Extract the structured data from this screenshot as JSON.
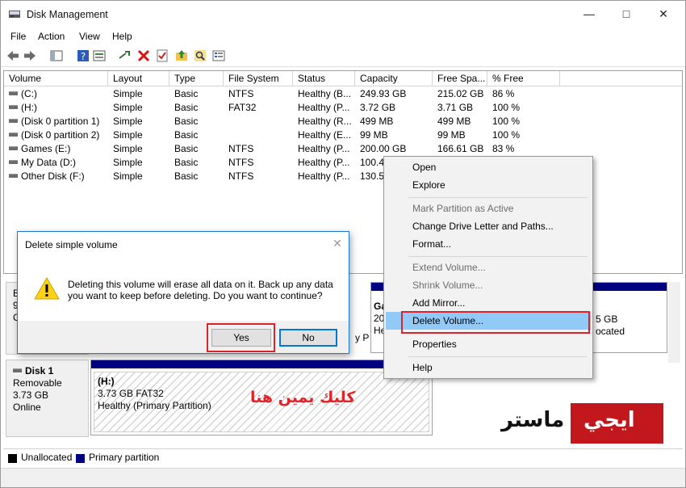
{
  "window": {
    "title": "Disk Management"
  },
  "menu": [
    "File",
    "Action",
    "View",
    "Help"
  ],
  "columns": [
    "Volume",
    "Layout",
    "Type",
    "File System",
    "Status",
    "Capacity",
    "Free Spa...",
    "% Free"
  ],
  "volumes": [
    {
      "volume": "(C:)",
      "layout": "Simple",
      "type": "Basic",
      "fs": "NTFS",
      "status": "Healthy (B...",
      "capacity": "249.93 GB",
      "free": "215.02 GB",
      "pct": "86 %"
    },
    {
      "volume": "(H:)",
      "layout": "Simple",
      "type": "Basic",
      "fs": "FAT32",
      "status": "Healthy (P...",
      "capacity": "3.72 GB",
      "free": "3.71 GB",
      "pct": "100 %"
    },
    {
      "volume": "(Disk 0 partition 1)",
      "layout": "Simple",
      "type": "Basic",
      "fs": "",
      "status": "Healthy (R...",
      "capacity": "499 MB",
      "free": "499 MB",
      "pct": "100 %"
    },
    {
      "volume": "(Disk 0 partition 2)",
      "layout": "Simple",
      "type": "Basic",
      "fs": "",
      "status": "Healthy (E...",
      "capacity": "99 MB",
      "free": "99 MB",
      "pct": "100 %"
    },
    {
      "volume": "Games (E:)",
      "layout": "Simple",
      "type": "Basic",
      "fs": "NTFS",
      "status": "Healthy (P...",
      "capacity": "200.00 GB",
      "free": "166.61 GB",
      "pct": "83 %"
    },
    {
      "volume": "My Data (D:)",
      "layout": "Simple",
      "type": "Basic",
      "fs": "NTFS",
      "status": "Healthy (P...",
      "capacity": "100.49",
      "free": "",
      "pct": ""
    },
    {
      "volume": "Other Disk (F:)",
      "layout": "Simple",
      "type": "Basic",
      "fs": "NTFS",
      "status": "Healthy (P...",
      "capacity": "130.53",
      "free": "",
      "pct": ""
    }
  ],
  "disk0_partial": {
    "label_letters": [
      "B",
      "9",
      "O"
    ],
    "games_frag": [
      "Ga",
      "20",
      "He"
    ],
    "size_frag": "y P",
    "right_frag": [
      "5 GB",
      "ocated"
    ]
  },
  "disk1": {
    "name": "Disk 1",
    "type": "Removable",
    "size": "3.73 GB",
    "state": "Online",
    "partition": {
      "name": "(H:)",
      "size_fs": "3.73 GB FAT32",
      "status": "Healthy (Primary Partition)"
    }
  },
  "legend": {
    "unallocated": "Unallocated",
    "primary": "Primary partition",
    "unallocated_color": "#000000",
    "primary_color": "#000080"
  },
  "dialog": {
    "title": "Delete simple volume",
    "message": "Deleting this volume will erase all data on it. Back up any data you want to keep before deleting. Do you want to continue?",
    "yes": "Yes",
    "no": "No"
  },
  "context_menu": {
    "items": [
      {
        "label": "Open",
        "enabled": true
      },
      {
        "label": "Explore",
        "enabled": true
      },
      {
        "label": "Mark Partition as Active",
        "enabled": false
      },
      {
        "label": "Change Drive Letter and Paths...",
        "enabled": true
      },
      {
        "label": "Format...",
        "enabled": true
      },
      {
        "label": "Extend Volume...",
        "enabled": false
      },
      {
        "label": "Shrink Volume...",
        "enabled": false
      },
      {
        "label": "Add Mirror...",
        "enabled": true
      },
      {
        "label": "Delete Volume...",
        "enabled": true,
        "highlighted": true
      },
      {
        "label": "Properties",
        "enabled": true
      },
      {
        "label": "Help",
        "enabled": true
      }
    ]
  },
  "annotation": {
    "text": "كليك يمين هنا"
  },
  "brand": {
    "part1": "ايجي",
    "part2": "ماستر"
  },
  "colors": {
    "accent_red": "#d9232d",
    "highlight": "#91c9f7",
    "primary_partition": "#000080",
    "brand_red": "#c1171d"
  }
}
